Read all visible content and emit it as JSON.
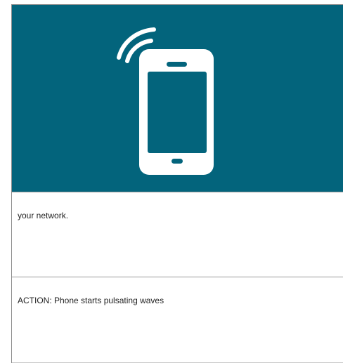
{
  "hero": {
    "background_color": "#03647c",
    "icon": "smartphone-signal-icon",
    "icon_color": "#ffffff"
  },
  "rows": [
    {
      "text": "your network."
    },
    {
      "text": "ACTION: Phone starts pulsating waves"
    }
  ]
}
